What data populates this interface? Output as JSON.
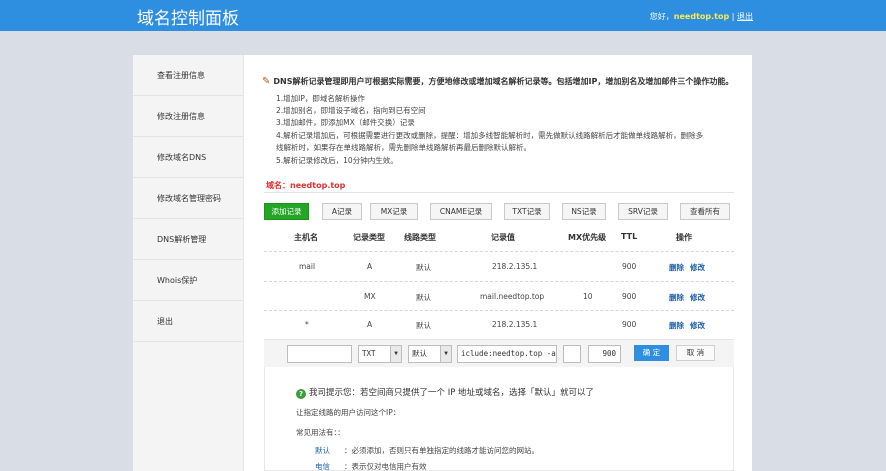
{
  "header": {
    "brand": "域名控制面板",
    "greeting": "您好，",
    "username": "needtop.top",
    "divider": "|",
    "logout": "退出"
  },
  "sidebar": {
    "items": [
      {
        "label": "查看注册信息"
      },
      {
        "label": "修改注册信息"
      },
      {
        "label": "修改域名DNS"
      },
      {
        "label": "修改域名管理密码"
      },
      {
        "label": "DNS解析管理"
      },
      {
        "label": "Whois保护"
      },
      {
        "label": "退出"
      }
    ]
  },
  "description": {
    "title": "DNS解析记录管理即用户可根据实际需要，方便地修改或增加域名解析记录等。包括增加IP，增加别名及增加邮件三个操作功能。",
    "lines": [
      "1.增加IP，即域名解析操作",
      "2.增加别名，即增设子域名，指向到已有空间",
      "3.增加邮件，即添加MX（邮件交换）记录",
      "4.解析记录增加后，可根据需要进行更改或删除，提醒：增加多线智能解析时，需先做默认线路解析后才能做单线路解析，删除多",
      "线解析时，如果存在单线路解析，需先删除单线路解析再最后删除默认解析。",
      "5.解析记录修改后，10分钟内生效。"
    ]
  },
  "domain_line": "域名：needtop.top",
  "toolbar": {
    "add": "添加记录",
    "a": "A记录",
    "mx": "MX记录",
    "cname": "CNAME记录",
    "txt": "TXT记录",
    "ns": "NS记录",
    "srv": "SRV记录",
    "all": "查看所有"
  },
  "table": {
    "headers": [
      "主机名",
      "记录类型",
      "线路类型",
      "记录值",
      "MX优先级",
      "TTL",
      "操作"
    ],
    "rows": [
      {
        "host": "mail",
        "type": "A",
        "line": "默认",
        "value": "218.2.135.1",
        "mx": "",
        "ttl": "900",
        "del": "删除",
        "edit": "修改"
      },
      {
        "host": "",
        "type": "MX",
        "line": "默认",
        "value": "mail.needtop.top",
        "mx": "10",
        "ttl": "900",
        "del": "删除",
        "edit": "修改"
      },
      {
        "host": "*",
        "type": "A",
        "line": "默认",
        "value": "218.2.135.1",
        "mx": "",
        "ttl": "900",
        "del": "删除",
        "edit": "修改"
      }
    ]
  },
  "edit_row": {
    "host_value": "",
    "type_value": "TXT",
    "line_value": "默认",
    "record_value": "iclude:needtop.top -all",
    "mx_value": "",
    "ttl_value": "900",
    "confirm": "确 定",
    "cancel": "取 消"
  },
  "tips": {
    "icon": "?",
    "title": "我司提示您：若空间商只提供了一个 IP 地址或域名，选择「默认」就可以了",
    "line1": "让指定线路的用户访问这个IP：",
    "line2": "常见用法有：：",
    "key1": "默认",
    "text1": "：必须添加，否则只有单独指定的线路才能访问您的网站。",
    "key2": "电信",
    "text2": "：表示仅对电信用户有效"
  },
  "colors": {
    "header_bg": "#2e8ee0",
    "add_button": "#25a525",
    "link_blue": "#1e5fa8",
    "domain_red": "#e03030"
  }
}
